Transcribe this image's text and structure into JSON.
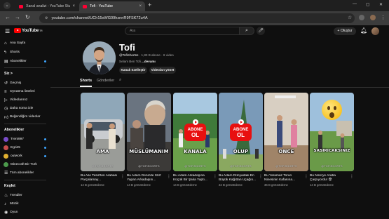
{
  "browser": {
    "tabs": [
      {
        "label": "Xanal analizi - YouTube Studio"
      },
      {
        "label": "Tofi - YouTube"
      }
    ],
    "url": "youtube.com/channel/UCh15xWG09hznnR9FSK72u4A"
  },
  "header": {
    "logo_text": "YouTube",
    "logo_suffix": "TR",
    "search_placeholder": "Ara",
    "create_label": "+ Oluştur"
  },
  "sidebar": {
    "main": [
      {
        "label": "Ana Sayfa",
        "icon": "home-icon"
      },
      {
        "label": "Shorts",
        "icon": "shorts-icon"
      },
      {
        "label": "Abonelikler",
        "icon": "subscriptions-icon"
      }
    ],
    "you_header": "Siz >",
    "you": [
      {
        "label": "Geçmiş",
        "icon": "history-icon"
      },
      {
        "label": "Oynatma listeleri",
        "icon": "playlist-icon"
      },
      {
        "label": "Videolarınız",
        "icon": "your-videos-icon"
      },
      {
        "label": "Daha sonra izle",
        "icon": "watch-later-icon"
      },
      {
        "label": "Beğendiğim videolar",
        "icon": "liked-icon"
      }
    ],
    "subs_header": "Abonelikler",
    "subs": [
      {
        "label": "Trent997",
        "color": "#7a4cc9"
      },
      {
        "label": "Egri45",
        "color": "#c94c4c"
      },
      {
        "label": "outwork",
        "color": "#e0b030"
      },
      {
        "label": "Minecraft Bir Türk",
        "color": "#4c9a4c"
      },
      {
        "label": "Tüm abonelikler",
        "color": "#555555"
      }
    ],
    "explore_header": "Keşfet",
    "explore": [
      {
        "label": "Trendler",
        "icon": "trending-icon"
      },
      {
        "label": "Müzik",
        "icon": "music-icon"
      },
      {
        "label": "Oyun",
        "icon": "gaming-icon"
      }
    ]
  },
  "channel": {
    "name": "Tofi",
    "handle": "@TofiShortss",
    "subscribers": "1,83 B abone",
    "videos": "6 video",
    "description": "Selam Ben Tofi",
    "more": "...devamı",
    "btn_customize": "Kanalı özelleştir",
    "btn_manage": "Videoları yönet",
    "tabs": [
      "Shorts",
      "Gönderiler"
    ]
  },
  "shorts": [
    {
      "caption": "AMA",
      "watermark": "@TOFISHORTS",
      "title": "Bu Aile Tesis'ten Arabası Parçalamay...",
      "views": "14 B görüntüleme"
    },
    {
      "caption": "MÜSLÜMANIM",
      "watermark": "@TOFISHORTS",
      "title": "Bu Adam Denizde Sörf Yapan Arkadaşını...",
      "views": "14 B görüntüleme"
    },
    {
      "caption": "KANALA",
      "watermark": "@TOFISHORTS",
      "title": "Bu Adam Arkadaşına Küçük Bir Şaka Yaptı...",
      "views": "14 B görüntüleme",
      "badge_top": "ABONE",
      "badge_bottom": "OL"
    },
    {
      "caption": "OLUP",
      "watermark": "@TOFISHORTS",
      "title": "Bu Adam Dünyadaki En Büyük Kağıttan Uçağın...",
      "views": "22 B görüntüleme",
      "badge_top": "ABONE",
      "badge_bottom": "OL"
    },
    {
      "caption": "ONCE",
      "watermark": "@TOFISHORTS",
      "title": "Bu Yaramaz Torun Ninesinin Kafasına...",
      "views": "36 B görüntüleme"
    },
    {
      "caption": "SASIRICAKSINIZ",
      "watermark": "@TOFISHORTS",
      "title": "Bu Nine'ye Araba Çarpıyordu! 😨",
      "views": "14 B görüntüleme"
    }
  ]
}
